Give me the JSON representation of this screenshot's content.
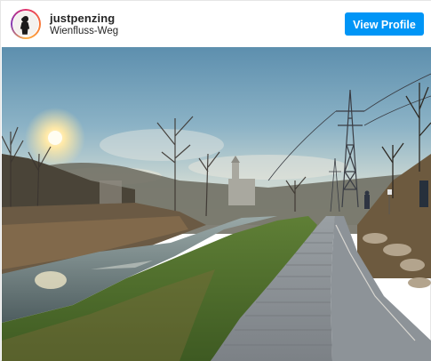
{
  "header": {
    "username": "justpenzing",
    "location": "Wienfluss-Weg",
    "view_profile_label": "View Profile"
  },
  "post": {
    "image_icon": "landscape-photo-river-path-power-pylon"
  },
  "colors": {
    "button": "#0095f6",
    "avatar_ring": "#e1306c"
  }
}
